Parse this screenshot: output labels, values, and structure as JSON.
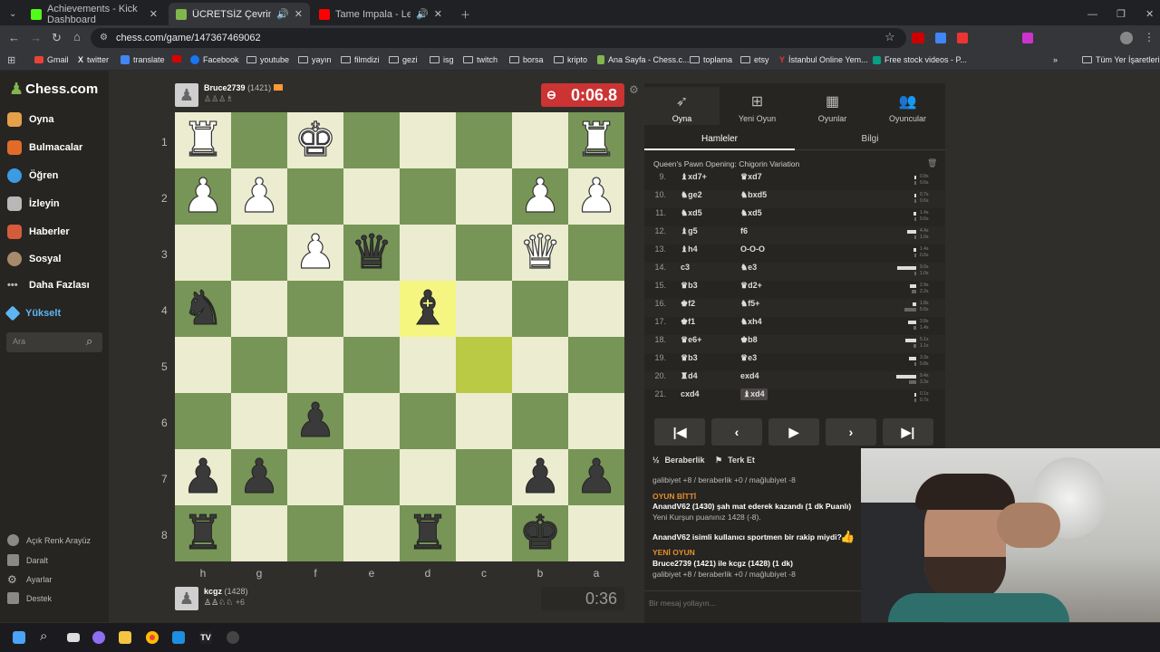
{
  "tabs": [
    {
      "title": "Achievements - Kick Dashboard",
      "color": "#53fc18"
    },
    {
      "title": "ÜCRETSİZ Çevrimiçi Satranç",
      "color": "#81b64c"
    },
    {
      "title": "Tame Impala - Let It Happen",
      "color": "#ff0000"
    }
  ],
  "url": "chess.com/game/147367469062",
  "bookmarks": [
    "Gmail",
    "twitter",
    "translate",
    "Facebook",
    "youtube",
    "yayın",
    "filmdizi",
    "gezi",
    "isg",
    "twitch",
    "borsa",
    "kripto",
    "Ana Sayfa - Chess.c...",
    "toplama",
    "etsy",
    "İstanbul Online Yem...",
    "Free stock videos - P...",
    "Tüm Yer İşaretleri"
  ],
  "sidebar": {
    "logo": "Chess.com",
    "items": [
      "Oyna",
      "Bulmacalar",
      "Öğren",
      "İzleyin",
      "Haberler",
      "Sosyal",
      "Daha Fazlası",
      "Yükselt"
    ],
    "search_placeholder": "Ara",
    "bottom": [
      "Açık Renk Arayüz",
      "Daralt",
      "Ayarlar",
      "Destek"
    ]
  },
  "top_player": {
    "name": "Bruce2739",
    "rating": "(1421)",
    "clock": "0:06.8"
  },
  "bottom_player": {
    "name": "kcgz",
    "rating": "(1428)",
    "extra": "+6",
    "clock": "0:36"
  },
  "board": {
    "ranks": [
      "1",
      "2",
      "3",
      "4",
      "5",
      "6",
      "7",
      "8"
    ],
    "files": [
      "h",
      "g",
      "f",
      "e",
      "d",
      "c",
      "b",
      "a"
    ],
    "rows": [
      [
        "wr",
        "",
        "wk",
        "",
        "",
        "",
        "",
        "wr"
      ],
      [
        "wp",
        "wp",
        "",
        "",
        "",
        "",
        "wp",
        "wp"
      ],
      [
        "",
        "",
        "wp",
        "bq",
        "",
        "",
        "wq",
        ""
      ],
      [
        "bn",
        "",
        "",
        "",
        "bb",
        "",
        "",
        ""
      ],
      [
        "",
        "",
        "",
        "",
        "",
        "",
        "",
        ""
      ],
      [
        "",
        "",
        "bp",
        "",
        "",
        "",
        "",
        ""
      ],
      [
        "bp",
        "bp",
        "",
        "",
        "",
        "",
        "bp",
        "bp"
      ],
      [
        "br",
        "",
        "",
        "",
        "br",
        "",
        "bk",
        ""
      ]
    ]
  },
  "panel": {
    "tabs": [
      "Oyna",
      "Yeni Oyun",
      "Oyunlar",
      "Oyuncular"
    ],
    "subtabs": [
      "Hamleler",
      "Bilgi"
    ],
    "opening": "Queen's Pawn Opening: Chigorin Variation",
    "moves": [
      {
        "n": "9.",
        "w": "♝xd7+",
        "b": "♛xd7",
        "t1": "0.8s",
        "t2": "0.6s"
      },
      {
        "n": "10.",
        "w": "♞ge2",
        "b": "♞bxd5",
        "t1": "0.7s",
        "t2": "0.6s"
      },
      {
        "n": "11.",
        "w": "♞xd5",
        "b": "♞xd5",
        "t1": "1.4s",
        "t2": "0.6s"
      },
      {
        "n": "12.",
        "w": "♝g5",
        "b": "f6",
        "t1": "4.4s",
        "t2": "1.0s"
      },
      {
        "n": "13.",
        "w": "♝h4",
        "b": "O-O-O",
        "t1": "1.4s",
        "t2": "0.6s"
      },
      {
        "n": "14.",
        "w": "c3",
        "b": "♞e3",
        "t1": "9.0s",
        "t2": "1.0s"
      },
      {
        "n": "15.",
        "w": "♛b3",
        "b": "♛d2+",
        "t1": "2.9s",
        "t2": "2.2s"
      },
      {
        "n": "16.",
        "w": "♚f2",
        "b": "♞f5+",
        "t1": "1.8s",
        "t2": "5.6s"
      },
      {
        "n": "17.",
        "w": "♚f1",
        "b": "♞xh4",
        "t1": "3.8s",
        "t2": "1.4s"
      },
      {
        "n": "18.",
        "w": "♛e6+",
        "b": "♚b8",
        "t1": "5.1s",
        "t2": "1.1s"
      },
      {
        "n": "19.",
        "w": "♛b3",
        "b": "♛e3",
        "t1": "3.3s",
        "t2": "0.8s"
      },
      {
        "n": "20.",
        "w": "♜d4",
        "b": "exd4",
        "t1": "9.4s",
        "t2": "3.3s"
      },
      {
        "n": "21.",
        "w": "cxd4",
        "b": "♝xd4",
        "t1": "0.1s",
        "t2": "0.7s"
      }
    ],
    "draw": "Beraberlik",
    "resign": "Terk Et",
    "chat": [
      "galibiyet +8 / beraberlik +0 / mağlubiyet -8",
      "OYUN BİTTİ",
      "AnandV62 (1430) şah mat ederek kazandı (1 dk Puanlı)",
      "Yeni Kurşun puanınız 1428 (-8).",
      "AnandV62 isimli kullanıcı sportmen bir rakip miydi?",
      "YENİ OYUN",
      "Bruce2739 (1421) ile kcgz (1428) (1 dk)",
      "galibiyet +8 / beraberlik +0 / mağlubiyet -8"
    ],
    "chat_placeholder": "Bir mesaj yollayın..."
  },
  "icons": [
    "back-icon",
    "forward-icon",
    "reload-icon",
    "home-icon",
    "star-icon",
    "gear-icon",
    "search-icon",
    "first-move-icon",
    "prev-move-icon",
    "play-icon",
    "next-move-icon",
    "last-move-icon",
    "thumbs-up-icon",
    "flag-icon"
  ]
}
